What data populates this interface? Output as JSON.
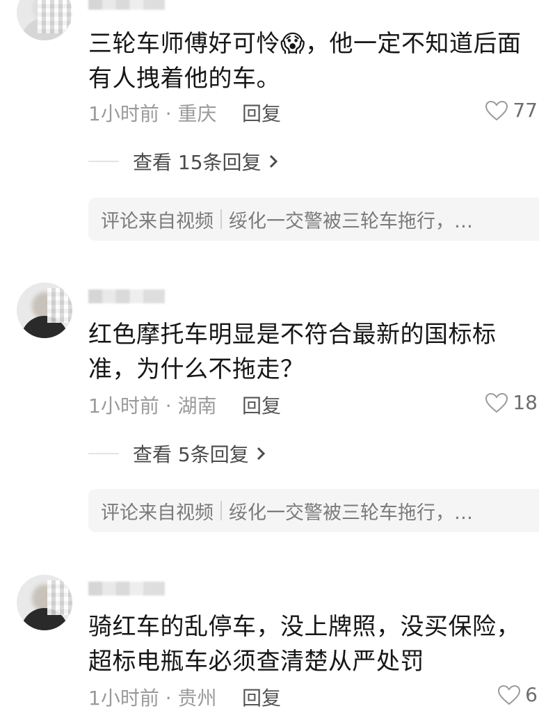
{
  "comments": [
    {
      "text": "三轮车师傅好可怜😱，他一定不知道后面有人拽着他的车。",
      "time_location": "1小时前 · 重庆",
      "reply_label": "回复",
      "likes": "77",
      "replies_label": "查看 15条回复",
      "source_prefix": "评论来自视频",
      "source_title": "绥化一交警被三轮车拖行，…"
    },
    {
      "text": "红色摩托车明显是不符合最新的国标标准，为什么不拖走？",
      "time_location": "1小时前 · 湖南",
      "reply_label": "回复",
      "likes": "18",
      "replies_label": "查看 5条回复",
      "source_prefix": "评论来自视频",
      "source_title": "绥化一交警被三轮车拖行，…"
    },
    {
      "text": "骑红车的乱停车，没上牌照，没买保险，超标电瓶车必须查清楚从严处罚",
      "time_location": "1小时前 · 贵州",
      "reply_label": "回复",
      "likes": "6"
    }
  ],
  "icons": {
    "heart": "heart-outline-icon",
    "chevron": "chevron-right-icon"
  }
}
